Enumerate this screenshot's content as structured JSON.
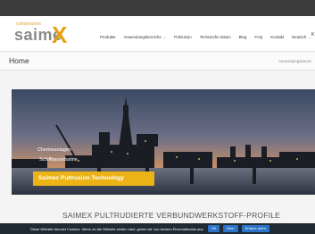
{
  "logo": {
    "small": "composites",
    "main": "saime",
    "x": "X"
  },
  "nav": {
    "items": [
      {
        "label": "Produkte",
        "has_dropdown": false
      },
      {
        "label": "Anwendungsbereiche",
        "has_dropdown": true
      },
      {
        "label": "Pultrusion",
        "has_dropdown": false
      },
      {
        "label": "Technische Daten",
        "has_dropdown": false
      },
      {
        "label": "Blog",
        "has_dropdown": false
      },
      {
        "label": "FAQ",
        "has_dropdown": false
      },
      {
        "label": "Kontakt",
        "has_dropdown": false
      },
      {
        "label": "Deutsch",
        "has_dropdown": true
      }
    ],
    "cut_char": "K"
  },
  "page": {
    "title": "Home",
    "breadcrumb": "Anwendungsbereic"
  },
  "hero": {
    "line1": "Chemieanlagen",
    "line2": "Schiffbauindustrie",
    "cta": "Saimex Pultrusion Technology"
  },
  "section": {
    "heading": "SAIMEX PULTRUDIERTE VERBUNDWERKSTOFF-PROFILE"
  },
  "cookie": {
    "text": "Diese Website benutzt Cookies. Wenn du die Website weiter nutzt, gehen wir von deinem Einverständnis aus.",
    "ok": "OK",
    "no": "Nein",
    "more": "Erfahre mehr"
  },
  "colors": {
    "accent": "#ecb316",
    "cookie_bar": "#1f2a33",
    "button_blue": "#2a73c8"
  },
  "icons": {
    "dropdown": "chevron-down-icon"
  }
}
